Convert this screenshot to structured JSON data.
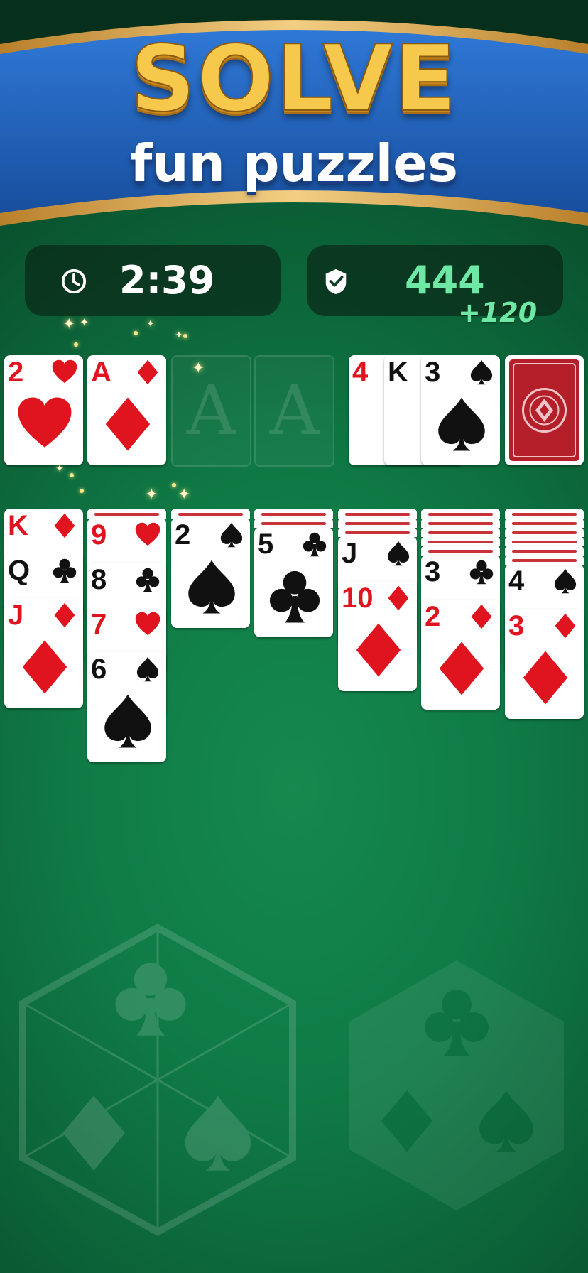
{
  "banner": {
    "headline": "SOLVE",
    "subheadline": "fun puzzles"
  },
  "stats": {
    "timer": "2:39",
    "score": "444",
    "score_bonus": "+120",
    "timer_icon": "clock-icon",
    "score_icon": "check-badge-icon"
  },
  "colors": {
    "felt": "#0f7a45",
    "banner_blue": "#1f5fbf",
    "gold": "#f6c94c",
    "score_green": "#6ee8a5",
    "card_red": "#e0141f"
  },
  "foundations": [
    {
      "rank": "2",
      "suit": "hearts"
    },
    {
      "rank": "A",
      "suit": "diamonds"
    },
    {
      "placeholder": "A"
    },
    {
      "placeholder": "A"
    }
  ],
  "waste": [
    {
      "rank": "4",
      "suit": "diamonds"
    },
    {
      "rank": "K",
      "suit": "clubs"
    },
    {
      "rank": "3",
      "suit": "spades"
    }
  ],
  "tableau": [
    [
      {
        "rank": "K",
        "suit": "diamonds"
      },
      {
        "rank": "Q",
        "suit": "clubs"
      },
      {
        "rank": "J",
        "suit": "diamonds"
      }
    ],
    [
      {
        "rank": "9",
        "suit": "hearts"
      },
      {
        "rank": "8",
        "suit": "clubs"
      },
      {
        "rank": "7",
        "suit": "hearts"
      },
      {
        "rank": "6",
        "suit": "spades"
      }
    ],
    [
      {
        "rank": "2",
        "suit": "spades"
      }
    ],
    [
      {
        "rank": "5",
        "suit": "clubs"
      }
    ],
    [
      {
        "rank": "J",
        "suit": "spades"
      },
      {
        "rank": "10",
        "suit": "diamonds"
      }
    ],
    [
      {
        "rank": "3",
        "suit": "clubs"
      },
      {
        "rank": "2",
        "suit": "diamonds"
      }
    ],
    [
      {
        "rank": "4",
        "suit": "spades"
      },
      {
        "rank": "3",
        "suit": "diamonds"
      }
    ]
  ],
  "hidden_counts": [
    0,
    1,
    1,
    2,
    3,
    5,
    6
  ]
}
